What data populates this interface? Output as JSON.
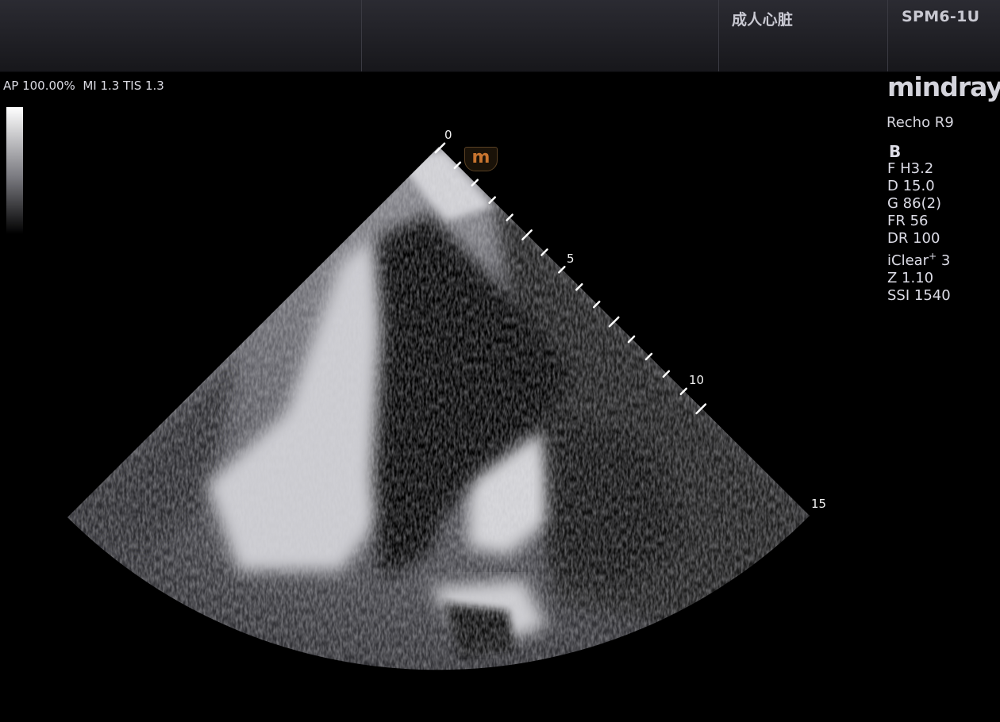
{
  "header": {
    "exam_label": "成人心脏",
    "probe_label": "SPM6-1U"
  },
  "acoustic_output": "AP 100.00%  MI 1.3 TIS 1.3",
  "brand": "mindray",
  "system_model": "Recho R9",
  "imaging": {
    "mode": "B",
    "params": [
      "F H3.2",
      "D 15.0",
      "G 86(2)",
      "FR 56",
      "DR 100",
      "Z 1.10",
      "SSI 1540"
    ],
    "iclear_label": "iClear",
    "iclear_sup": "+",
    "iclear_value": "3"
  },
  "depth_scale": {
    "labels": [
      "0",
      "5",
      "10",
      "15"
    ]
  },
  "orientation_marker": "m",
  "colors": {
    "marker_orange": "#c8742f",
    "background": "#000000"
  }
}
